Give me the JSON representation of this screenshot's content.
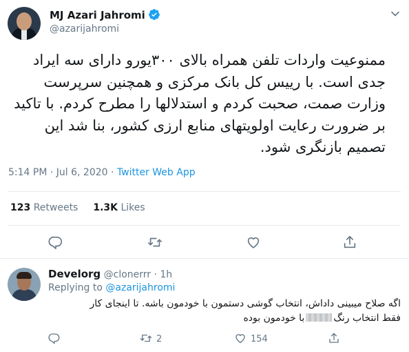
{
  "tweet": {
    "author_name": "MJ Azari Jahromi",
    "handle": "@azarijahromi",
    "text_lines": [
      "ممنوعیت واردات تلفن همراه بالای ۳۰۰یورو دارای سه ایراد",
      "جدی است. با رییس کل بانک مرکزی و همچنین سرپرست",
      "وزارت صمت، صحبت کردم و استدلالها را مطرح کردم. با تاکید",
      "بر ضرورت رعایت اولویتهای منابع ارزی کشور، بنا شد این",
      "تصمیم بازنگری شود."
    ],
    "time": "5:14 PM · Jul 6, 2020 · ",
    "app": "Twitter Web App",
    "retweets_count": "123",
    "retweets_label": "Retweets",
    "likes_count": "1.3K",
    "likes_label": "Likes"
  },
  "reply": {
    "author_name": "Develorg",
    "handle": "@clonerrr",
    "time": "· 1h",
    "replying_prefix": "Replying to ",
    "replying_to": "@azarijahromi",
    "text_line1": "اگه صلاح میبینی داداش، انتخاب گوشی دستمون با خودمون باشه. تا اینجای کار",
    "text_line2_a": "فقط انتخاب رنگ",
    "text_line2_b": "با خودمون بوده",
    "retweet_count": "2",
    "like_count": "154"
  },
  "icons": {
    "verified": "verified-badge-icon",
    "more": "chevron-down-icon",
    "reply": "reply-icon",
    "retweet": "retweet-icon",
    "like": "heart-icon",
    "share": "share-icon"
  },
  "colors": {
    "accent": "#1b95e0",
    "secondary_text": "#657786",
    "divider": "#e6ecf0"
  }
}
